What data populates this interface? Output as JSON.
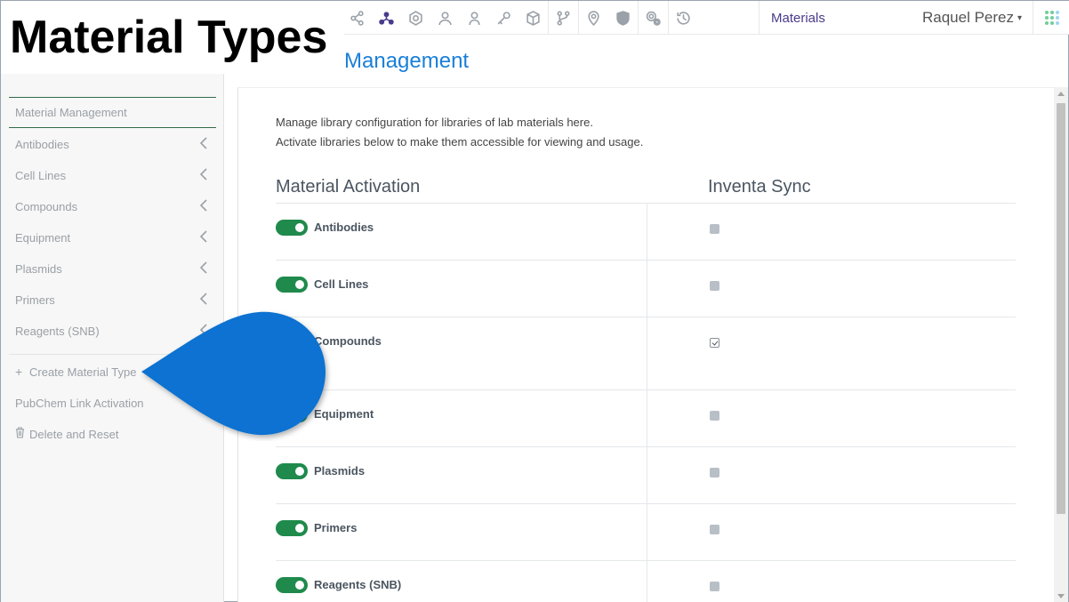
{
  "overlay_title": "Material Types",
  "topbar": {
    "icons": [
      "share-icon",
      "network-icon",
      "hexagon-icon",
      "users-icon",
      "user-icon",
      "key-icon",
      "cube-icon",
      "branch-icon",
      "location-pin-icon",
      "shield-icon",
      "gear-icon",
      "history-icon"
    ],
    "active_icon": "network-icon",
    "section_label": "Materials",
    "user_name": "Raquel Perez",
    "user_caret": "▾"
  },
  "page_heading": "Management",
  "sidebar": {
    "header": "Material Management",
    "items": [
      {
        "label": "Antibodies"
      },
      {
        "label": "Cell Lines"
      },
      {
        "label": "Compounds"
      },
      {
        "label": "Equipment"
      },
      {
        "label": "Plasmids"
      },
      {
        "label": "Primers"
      },
      {
        "label": "Reagents (SNB)"
      }
    ],
    "actions": [
      {
        "label": "Create Material Type",
        "icon": "plus-icon",
        "glyph": "+"
      },
      {
        "label": "PubChem Link Activation",
        "icon": "",
        "glyph": ""
      },
      {
        "label": "Delete and Reset",
        "icon": "trash-icon",
        "glyph": "🗑"
      }
    ]
  },
  "content": {
    "description_line1": "Manage library configuration for libraries of lab materials here.",
    "description_line2": "Activate libraries below to make them accessible for viewing and usage.",
    "col_activation": "Material Activation",
    "col_sync": "Inventa Sync",
    "rows": [
      {
        "label": "Antibodies",
        "active": true,
        "sync": false
      },
      {
        "label": "Cell Lines",
        "active": true,
        "sync": false
      },
      {
        "label": "Compounds",
        "active": true,
        "sync": true
      },
      {
        "label": "Equipment",
        "active": true,
        "sync": false
      },
      {
        "label": "Plasmids",
        "active": true,
        "sync": false
      },
      {
        "label": "Primers",
        "active": true,
        "sync": false
      },
      {
        "label": "Reagents (SNB)",
        "active": true,
        "sync": false
      }
    ]
  },
  "colors": {
    "accent": "#1a7fd8",
    "toggle_on": "#1f8a4c",
    "callout": "#0a72d1",
    "nav_active": "#4a3a8c"
  }
}
